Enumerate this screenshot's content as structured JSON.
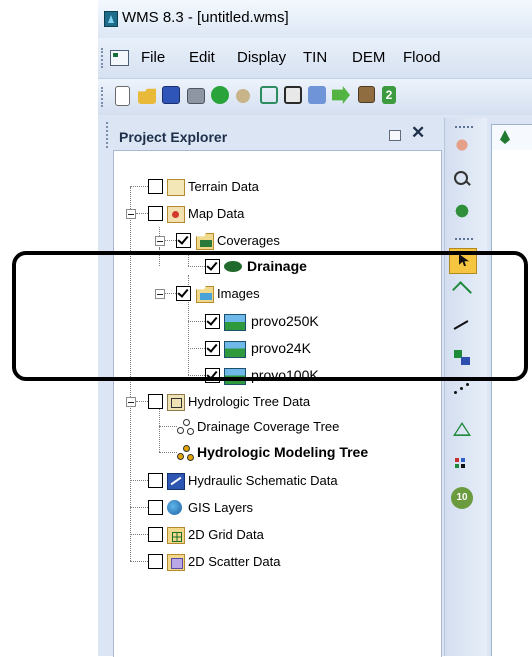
{
  "window": {
    "title": "WMS 8.3 - [untitled.wms]"
  },
  "menu": [
    "File",
    "Edit",
    "Display",
    "TIN",
    "DEM",
    "Flood"
  ],
  "toolbar_icons": [
    "new-icon",
    "open-icon",
    "save-icon",
    "print-icon",
    "go-icon",
    "find-icon",
    "frame-icon",
    "zoom-extents-icon",
    "grid-icon",
    "arrow-icon",
    "properties-icon",
    "help-icon"
  ],
  "explorer": {
    "title": "Project Explorer",
    "items": [
      {
        "label": "Terrain Data",
        "checked": false,
        "icon": "terrain-data-icon"
      },
      {
        "label": "Map Data",
        "checked": false,
        "icon": "map-data-icon"
      },
      {
        "label": "Coverages",
        "checked": true,
        "icon": "coverages-icon"
      },
      {
        "label": "Drainage",
        "checked": true,
        "icon": "drainage-coverage-icon"
      },
      {
        "label": "Images",
        "checked": true,
        "icon": "images-folder-icon"
      },
      {
        "label": "provo250K",
        "checked": true,
        "icon": "image-icon"
      },
      {
        "label": "provo24K",
        "checked": true,
        "icon": "image-icon"
      },
      {
        "label": "provo100K",
        "checked": true,
        "icon": "image-icon"
      },
      {
        "label": "Hydrologic Tree Data",
        "checked": false,
        "icon": "hydrologic-tree-data-icon"
      },
      {
        "label": "Drainage Coverage Tree",
        "icon": "tree-icon"
      },
      {
        "label": "Hydrologic Modeling Tree",
        "icon": "tree-icon"
      },
      {
        "label": "Hydraulic Schematic Data",
        "checked": false,
        "icon": "hydraulic-schematic-icon"
      },
      {
        "label": "GIS Layers",
        "checked": false,
        "icon": "globe-icon"
      },
      {
        "label": "2D Grid Data",
        "checked": false,
        "icon": "grid-data-icon"
      },
      {
        "label": "2D Scatter Data",
        "checked": false,
        "icon": "scatter-data-icon"
      }
    ]
  },
  "side_tools": [
    "pan-tool-icon",
    "zoom-tool-icon",
    "rotate-tool-icon",
    "select-tool-icon",
    "create-outlet-icon",
    "create-arc-icon",
    "select-feature-icon",
    "create-vertex-icon",
    "triangle-tool-icon",
    "select-point-icon",
    "tool-10-icon"
  ],
  "colors": {
    "accent": "#1e2f4a",
    "highlight": "#000000",
    "selected_tool": "#f5c542"
  }
}
